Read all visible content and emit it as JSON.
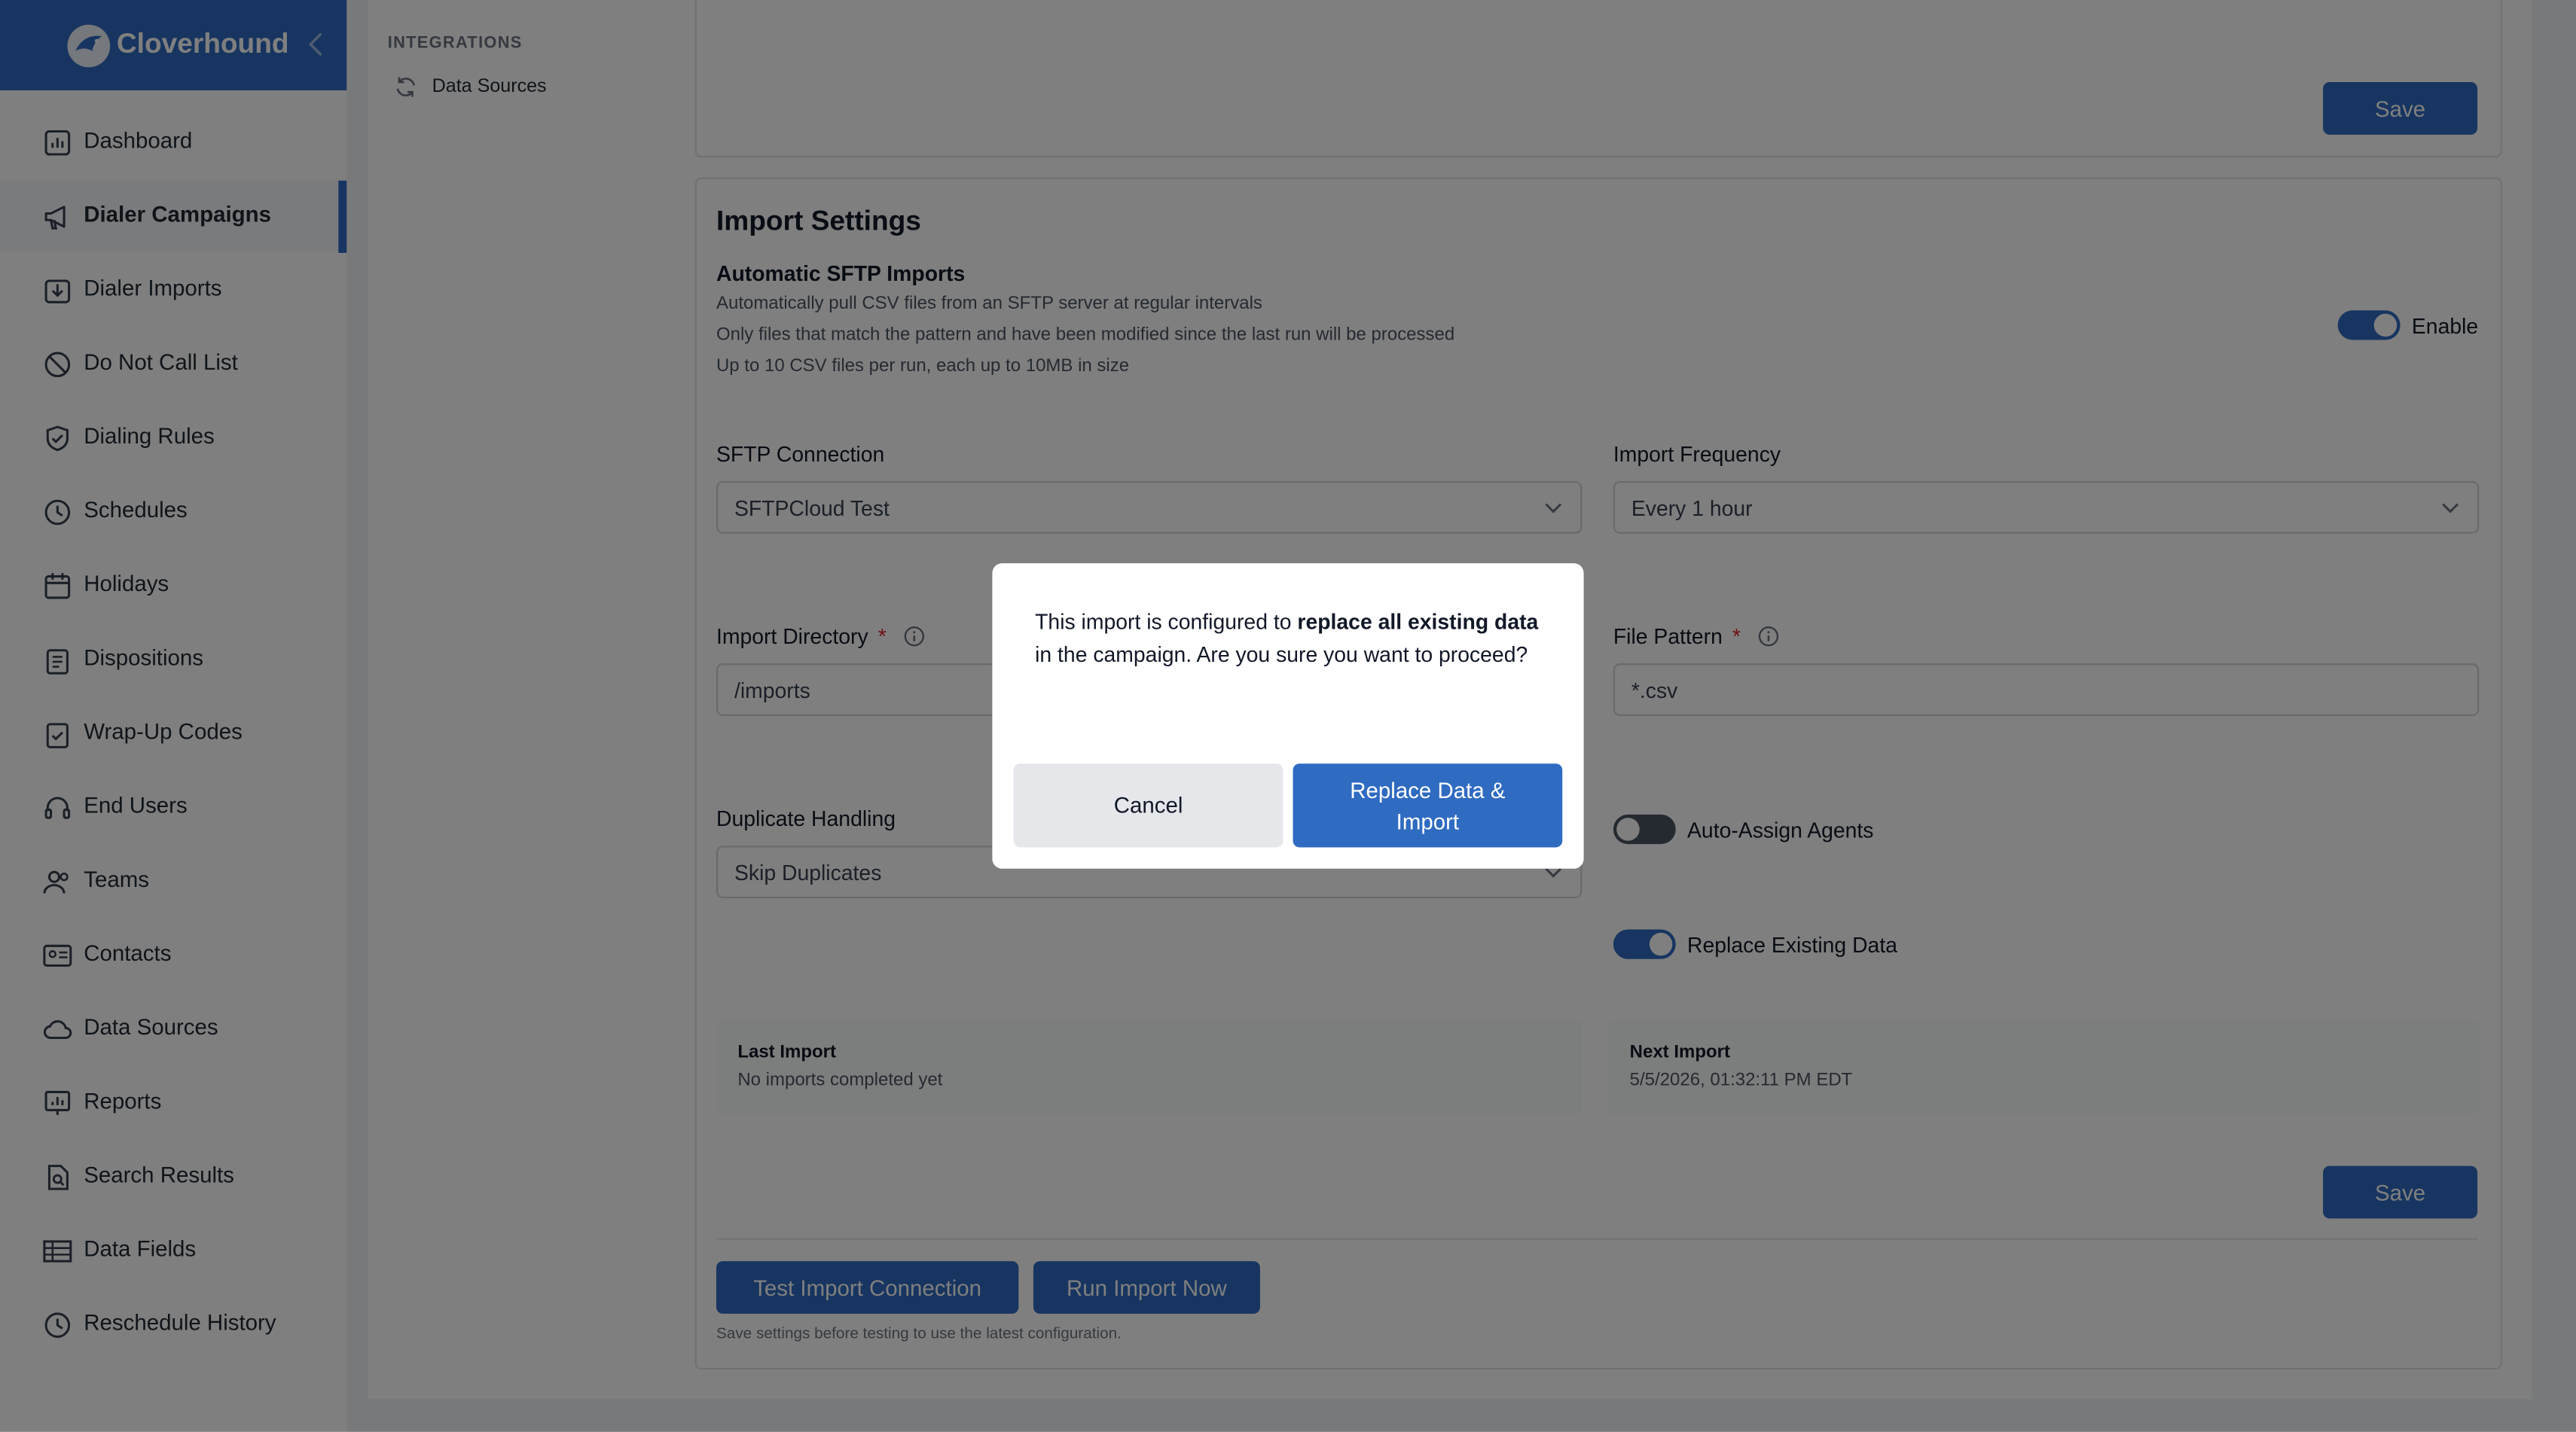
{
  "brand": {
    "name": "Cloverhound"
  },
  "sidebar": {
    "items": [
      {
        "label": "Dashboard"
      },
      {
        "label": "Dialer Campaigns"
      },
      {
        "label": "Dialer Imports"
      },
      {
        "label": "Do Not Call List"
      },
      {
        "label": "Dialing Rules"
      },
      {
        "label": "Schedules"
      },
      {
        "label": "Holidays"
      },
      {
        "label": "Dispositions"
      },
      {
        "label": "Wrap-Up Codes"
      },
      {
        "label": "End Users"
      },
      {
        "label": "Teams"
      },
      {
        "label": "Contacts"
      },
      {
        "label": "Data Sources"
      },
      {
        "label": "Reports"
      },
      {
        "label": "Search Results"
      },
      {
        "label": "Data Fields"
      },
      {
        "label": "Reschedule History"
      }
    ]
  },
  "subpanel": {
    "section": "INTEGRATIONS",
    "item": "Data Sources"
  },
  "top_card": {
    "save_label": "Save"
  },
  "import_settings": {
    "title": "Import Settings",
    "subtitle": "Automatic SFTP Imports",
    "desc1": "Automatically pull CSV files from an SFTP server at regular intervals",
    "desc2": "Only files that match the pattern and have been modified since the last run will be processed",
    "desc3": "Up to 10 CSV files per run, each up to 10MB in size",
    "enable_label": "Enable",
    "sftp_connection_label": "SFTP Connection",
    "sftp_connection_value": "SFTPCloud Test",
    "frequency_label": "Import Frequency",
    "frequency_value": "Every 1 hour",
    "directory_label": "Import Directory",
    "directory_value": "/imports",
    "pattern_label": "File Pattern",
    "pattern_value": "*.csv",
    "required_mark": "*",
    "duplicate_label": "Duplicate Handling",
    "duplicate_value": "Skip Duplicates",
    "auto_assign_label": "Auto-Assign Agents",
    "replace_label": "Replace Existing Data",
    "last_import_label": "Last Import",
    "last_import_value": "No imports completed yet",
    "next_import_label": "Next Import",
    "next_import_value": "5/5/2026, 01:32:11 PM EDT",
    "save_label": "Save",
    "test_label": "Test Import Connection",
    "run_label": "Run Import Now",
    "hint": "Save settings before testing to use the latest configuration."
  },
  "dialog": {
    "msg_part1": "This import is configured to ",
    "msg_bold": "replace all existing data",
    "msg_part2": " in the campaign. Are you sure you want to proceed?",
    "cancel_label": "Cancel",
    "confirm_label": "Replace Data & Import"
  },
  "colors": {
    "accent": "#2f6bc1",
    "overlay": "rgba(0,0,0,0.5)"
  }
}
